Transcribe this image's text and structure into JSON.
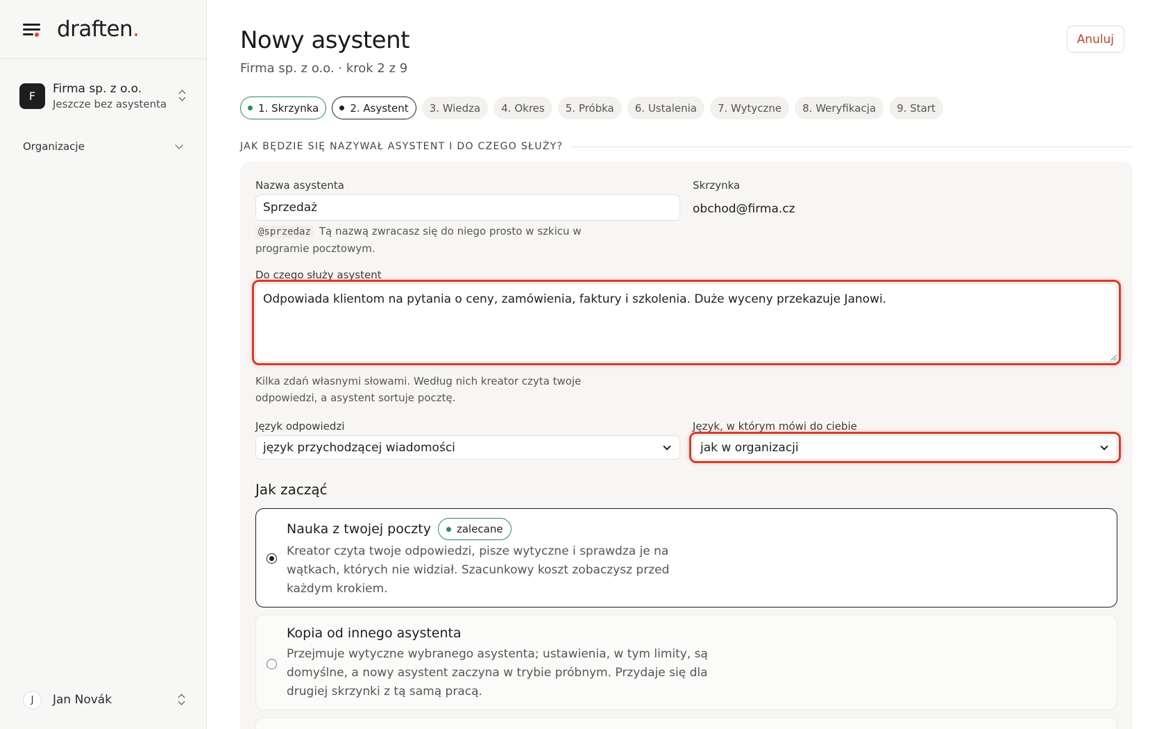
{
  "brand": {
    "name": "draften",
    "accent_char": "."
  },
  "colors": {
    "accent": "#e0442a",
    "success": "#2c8a5b",
    "danger": "#d43c2a",
    "text": "#1e1e1e"
  },
  "sidebar": {
    "org": {
      "avatar": "F",
      "name": "Firma sp. z o.o.",
      "sub": "Jeszcze bez asystenta"
    },
    "nav": {
      "organizations": "Organizacje"
    },
    "user": {
      "avatar": "J",
      "name": "Jan Novák"
    }
  },
  "header": {
    "title": "Nowy asystent",
    "subtitle": "Firma sp. z o.o. · krok 2 z 9",
    "cancel": "Anuluj"
  },
  "steps": [
    {
      "label": "1. Skrzynka",
      "state": "done"
    },
    {
      "label": "2. Asystent",
      "state": "current"
    },
    {
      "label": "3. Wiedza",
      "state": "todo"
    },
    {
      "label": "4. Okres",
      "state": "todo"
    },
    {
      "label": "5. Próbka",
      "state": "todo"
    },
    {
      "label": "6. Ustalenia",
      "state": "todo"
    },
    {
      "label": "7. Wytyczne",
      "state": "todo"
    },
    {
      "label": "8. Weryfikacja",
      "state": "todo"
    },
    {
      "label": "9. Start",
      "state": "todo"
    }
  ],
  "form": {
    "section_heading": "JAK BĘDZIE SIĘ NAZYWAŁ ASYSTENT I DO CZEGO SŁUŻY?",
    "name_label": "Nazwa asystenta",
    "name_value": "Sprzedaż",
    "handle": "@sprzedaz",
    "name_hint_line1": "Tą nazwą zwracasz się do niego prosto w szkicu w",
    "name_hint_line2": "programie pocztowym.",
    "mailbox_label": "Skrzynka",
    "mailbox_value": "obchod@firma.cz",
    "purpose_label": "Do czego służy asystent",
    "purpose_value": "Odpowiada klientom na pytania o ceny, zamówienia, faktury i szkolenia. Duże wyceny przekazuje Janowi.",
    "purpose_hint_line1": "Kilka zdań własnymi słowami. Według nich kreator czyta twoje",
    "purpose_hint_line2": "odpowiedzi, a asystent sortuje pocztę.",
    "reply_lang_label": "Język odpowiedzi",
    "reply_lang_value": "język przychodzącej wiadomości",
    "ui_lang_label": "Język, w którym mówi do ciebie",
    "ui_lang_value": "jak w organizacji"
  },
  "start": {
    "heading": "Jak zacząć",
    "options": [
      {
        "title": "Nauka z twojej poczty",
        "badge": "zalecane",
        "desc_line1": "Kreator czyta twoje odpowiedzi, pisze wytyczne i sprawdza je na",
        "desc_line2": "wątkach, których nie widział. Szacunkowy koszt zobaczysz przed",
        "desc_line3": "każdym krokiem.",
        "selected": true
      },
      {
        "title": "Kopia od innego asystenta",
        "desc_line1": "Przejmuje wytyczne wybranego asystenta; ustawienia, w tym limity, są",
        "desc_line2": "domyślne, a nowy asystent zaczyna w trybie próbnym. Przydaje się dla",
        "desc_line3": "drugiej skrzynki z tą samą pracą.",
        "selected": false
      }
    ]
  }
}
